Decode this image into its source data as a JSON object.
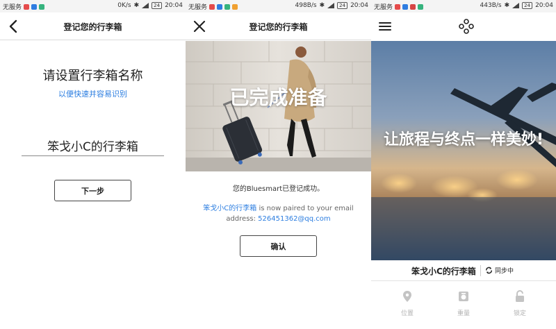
{
  "status_bars": [
    {
      "carrier": "无服务",
      "speed": "0K/s",
      "battery": "24",
      "time": "20:04"
    },
    {
      "carrier": "无服务",
      "speed": "498B/s",
      "battery": "24",
      "time": "20:04"
    },
    {
      "carrier": "无服务",
      "speed": "443B/s",
      "battery": "24",
      "time": "20:04"
    }
  ],
  "screen1": {
    "header_title": "登记您的行李箱",
    "prompt_title": "请设置行李箱名称",
    "prompt_subtitle": "以便快速并容易识别",
    "name_value": "笨戈小C的行李箱",
    "next_button": "下一步"
  },
  "screen2": {
    "header_title": "登记您的行李箱",
    "hero_text": "已完成准备",
    "success_text": "您的Bluesmart已登记成功。",
    "suitcase_name": "笨戈小C的行李箱",
    "paired_text": " is now paired to your email address: ",
    "email": "526451362@qq.com",
    "confirm_button": "确认"
  },
  "screen3": {
    "slogan": "让旅程与终点一样美妙!",
    "suitcase_name": "笨戈小C的行李箱",
    "sync_status": "同步中",
    "tabs": [
      {
        "label": "位置",
        "icon": "location-pin-icon"
      },
      {
        "label": "重量",
        "icon": "scale-icon"
      },
      {
        "label": "锁定",
        "icon": "lock-icon"
      }
    ]
  }
}
